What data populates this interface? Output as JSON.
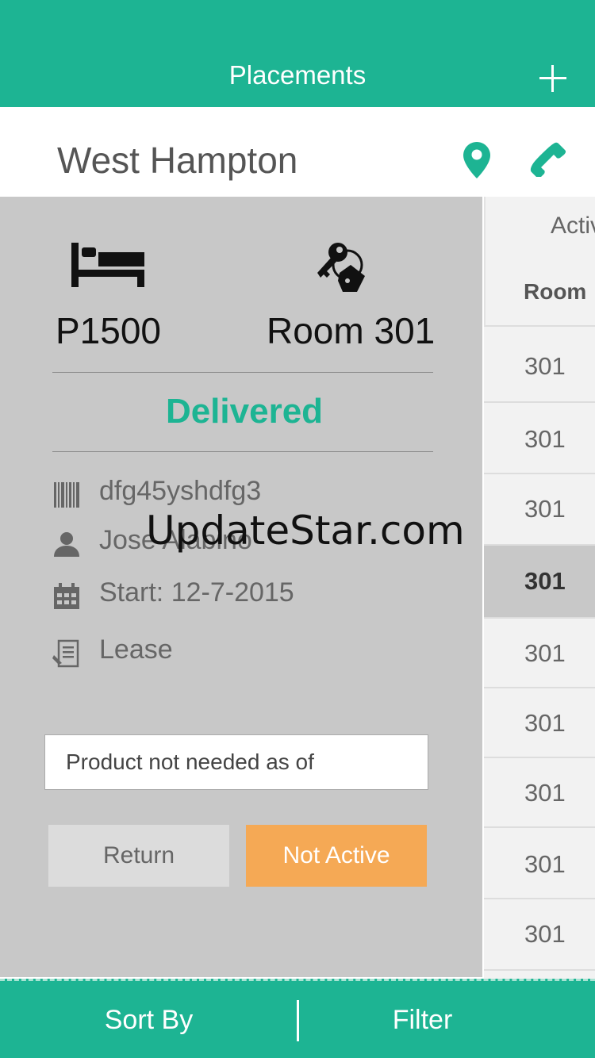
{
  "header": {
    "title": "Placements",
    "add_icon": "plus-icon"
  },
  "location": {
    "name": "West Hampton",
    "icons": [
      "map-pin-icon",
      "phone-icon"
    ]
  },
  "detail": {
    "product_id": "P1500",
    "room": "Room 301",
    "status": "Delivered",
    "info": [
      {
        "icon": "barcode-icon",
        "text": "dfg45yshdfg3"
      },
      {
        "icon": "person-icon",
        "text": "Jose Alabino"
      },
      {
        "icon": "calendar-icon",
        "text": "Start: 12-7-2015"
      },
      {
        "icon": "document-icon",
        "text": "Lease"
      }
    ],
    "note_value": "Product not needed as of",
    "return_label": "Return",
    "not_active_label": "Not Active"
  },
  "table": {
    "header_active": "Activ",
    "header_room": "Room",
    "rows": [
      "301",
      "301",
      "301",
      "301",
      "301",
      "301",
      "301",
      "301",
      "301"
    ],
    "selected_index": 3
  },
  "bottom": {
    "sort_label": "Sort By",
    "filter_label": "Filter"
  },
  "watermark": "UpdateStar.com",
  "colors": {
    "accent": "#1db493",
    "warning": "#f5a955",
    "panel": "#c8c8c8"
  }
}
